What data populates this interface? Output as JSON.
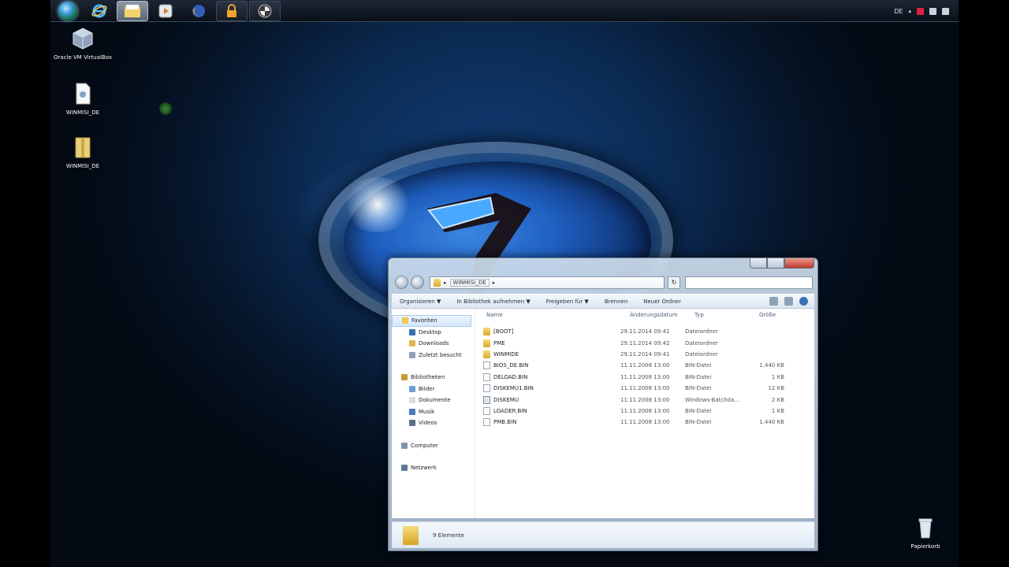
{
  "taskbar": {
    "tray": {
      "language": "DE"
    }
  },
  "desktop": {
    "icons": [
      {
        "label": "Oracle VM VirtualBox"
      },
      {
        "label": "WINMISI_DE"
      },
      {
        "label": "WINMISI_DE"
      },
      {
        "label": "Papierkorb"
      }
    ]
  },
  "explorer": {
    "address": {
      "crumb": "WINMISI_DE"
    },
    "toolbar": {
      "organize": "Organisieren ▼",
      "include": "In Bibliothek aufnehmen ▼",
      "share": "Freigeben für ▼",
      "burn": "Brennen",
      "new_folder": "Neuer Ordner"
    },
    "nav": {
      "favorites": "Favoriten",
      "desktop": "Desktop",
      "downloads": "Downloads",
      "recent": "Zuletzt besucht",
      "libraries": "Bibliotheken",
      "pictures": "Bilder",
      "documents": "Dokumente",
      "music": "Musik",
      "videos": "Videos",
      "computer": "Computer",
      "network": "Netzwerk"
    },
    "columns": {
      "name": "Name",
      "date": "Änderungsdatum",
      "type": "Typ",
      "size": "Größe"
    },
    "files": [
      {
        "name": "[BOOT]",
        "date": "29.11.2014 09:41",
        "type": "Dateiordner",
        "size": "",
        "kind": "folder"
      },
      {
        "name": "PME",
        "date": "29.11.2014 09:42",
        "type": "Dateiordner",
        "size": "",
        "kind": "folder"
      },
      {
        "name": "WINMIDE",
        "date": "29.11.2014 09:41",
        "type": "Dateiordner",
        "size": "",
        "kind": "folder"
      },
      {
        "name": "BIOS_DE.BIN",
        "date": "11.11.2008 13:00",
        "type": "BIN-Datei",
        "size": "1.440 KB",
        "kind": "file"
      },
      {
        "name": "DELOAD.BIN",
        "date": "11.11.2008 13:00",
        "type": "BIN-Datei",
        "size": "1 KB",
        "kind": "file"
      },
      {
        "name": "DISKEMU1.BIN",
        "date": "11.11.2008 13:00",
        "type": "BIN-Datei",
        "size": "12 KB",
        "kind": "file"
      },
      {
        "name": "DISKEMU",
        "date": "11.11.2008 13:00",
        "type": "Windows-Batchda...",
        "size": "2 KB",
        "kind": "exe"
      },
      {
        "name": "LOADER.BIN",
        "date": "11.11.2008 13:00",
        "type": "BIN-Datei",
        "size": "1 KB",
        "kind": "file"
      },
      {
        "name": "PMB.BIN",
        "date": "11.11.2008 13:00",
        "type": "BIN-Datei",
        "size": "1.440 KB",
        "kind": "file"
      }
    ],
    "status": {
      "count": "9 Elemente"
    }
  }
}
